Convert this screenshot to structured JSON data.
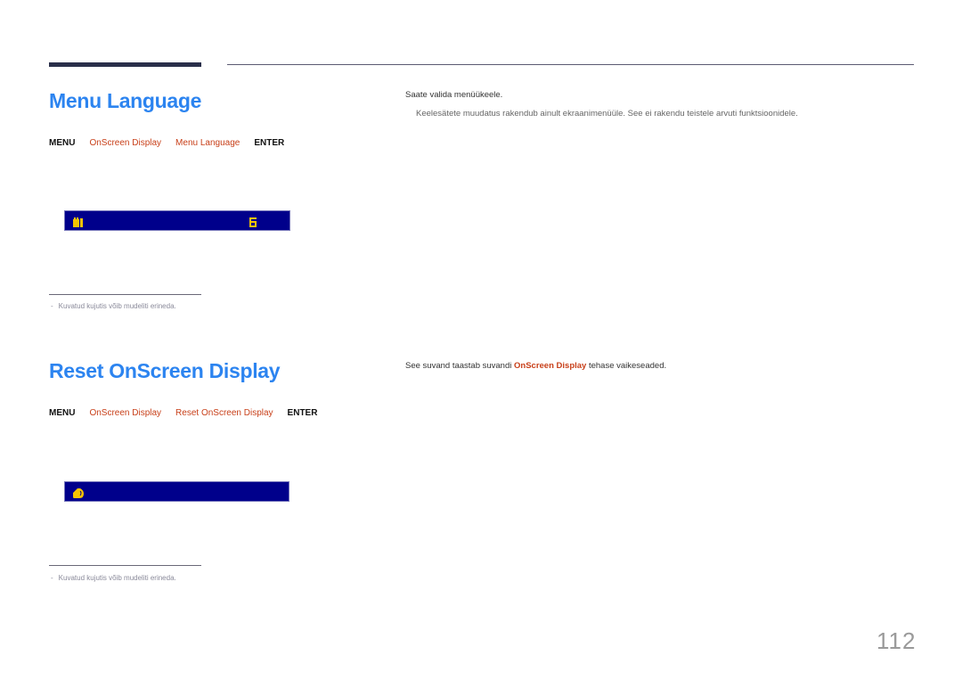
{
  "page_number": "112",
  "sections": [
    {
      "title": "Menu Language",
      "path": {
        "menu": "MENU",
        "level1": "OnScreen Display",
        "level2": "Menu Language",
        "enter": "ENTER"
      },
      "osd_icons": [
        "menu-language-glyph-icon",
        "value-glyph-icon"
      ],
      "footnote": "Kuvatud kujutis võib mudeliti erineda.",
      "footnote_bullet": "-",
      "description": "Saate valida menüükeele.",
      "note": "Keelesätete muudatus rakendub ainult ekraanimenüüle. See ei rakendu teistele arvuti funktsioonidele."
    },
    {
      "title": "Reset OnScreen Display",
      "path": {
        "menu": "MENU",
        "level1": "OnScreen Display",
        "level2": "Reset OnScreen Display",
        "enter": "ENTER"
      },
      "osd_icons": [
        "reset-glyph-icon"
      ],
      "footnote": "Kuvatud kujutis võib mudeliti erineda.",
      "footnote_bullet": "-",
      "description_before": "See suvand taastab suvandi ",
      "description_highlight": "OnScreen Display",
      "description_after": " tehase vaikeseaded."
    }
  ],
  "colors": {
    "title": "#2c84f0",
    "menu_link": "#c8401a",
    "osd_background": "#00008b",
    "osd_icon": "#f5c400",
    "header_bar": "#2a2f4a"
  }
}
